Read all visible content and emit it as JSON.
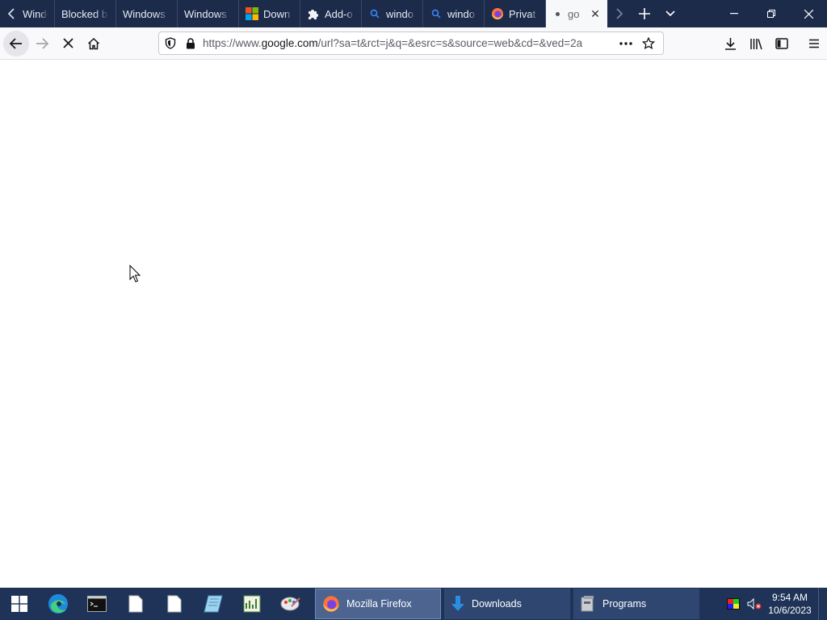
{
  "browser": {
    "tabs": [
      {
        "label": "Windo",
        "icon": "window-icon"
      },
      {
        "label": "Blocked b",
        "icon": ""
      },
      {
        "label": "Windows",
        "icon": ""
      },
      {
        "label": "Windows",
        "icon": ""
      },
      {
        "label": "Down",
        "icon": "microsoft-logo-icon"
      },
      {
        "label": "Add-o",
        "icon": "puzzle-icon"
      },
      {
        "label": "windo",
        "icon": "search-icon"
      },
      {
        "label": "windo",
        "icon": "search-icon"
      },
      {
        "label": "Privat",
        "icon": "firefox-icon"
      },
      {
        "label": "go",
        "icon": "loading-dot-icon",
        "active": true
      }
    ],
    "url": {
      "prefix": "https://www.",
      "host": "google.com",
      "path": "/url?sa=t&rct=j&q=&esrc=s&source=web&cd=&ved=2a"
    }
  },
  "taskbar": {
    "pinned": [
      "start-icon",
      "edge-icon",
      "terminal-icon",
      "file-icon",
      "file-icon",
      "notepad-icon",
      "chart-app-icon",
      "paint-icon"
    ],
    "tasks": [
      {
        "label": "Mozilla Firefox",
        "icon": "firefox-icon",
        "active": true
      },
      {
        "label": "Downloads",
        "icon": "download-icon",
        "active": false
      },
      {
        "label": "Programs",
        "icon": "programs-icon",
        "active": false
      }
    ],
    "clock": {
      "time": "9:54 AM",
      "date": "10/6/2023"
    }
  },
  "colors": {
    "titlebar": "#1c2b4a",
    "taskbar": "#1f3358",
    "active_task": "#4d6490"
  }
}
